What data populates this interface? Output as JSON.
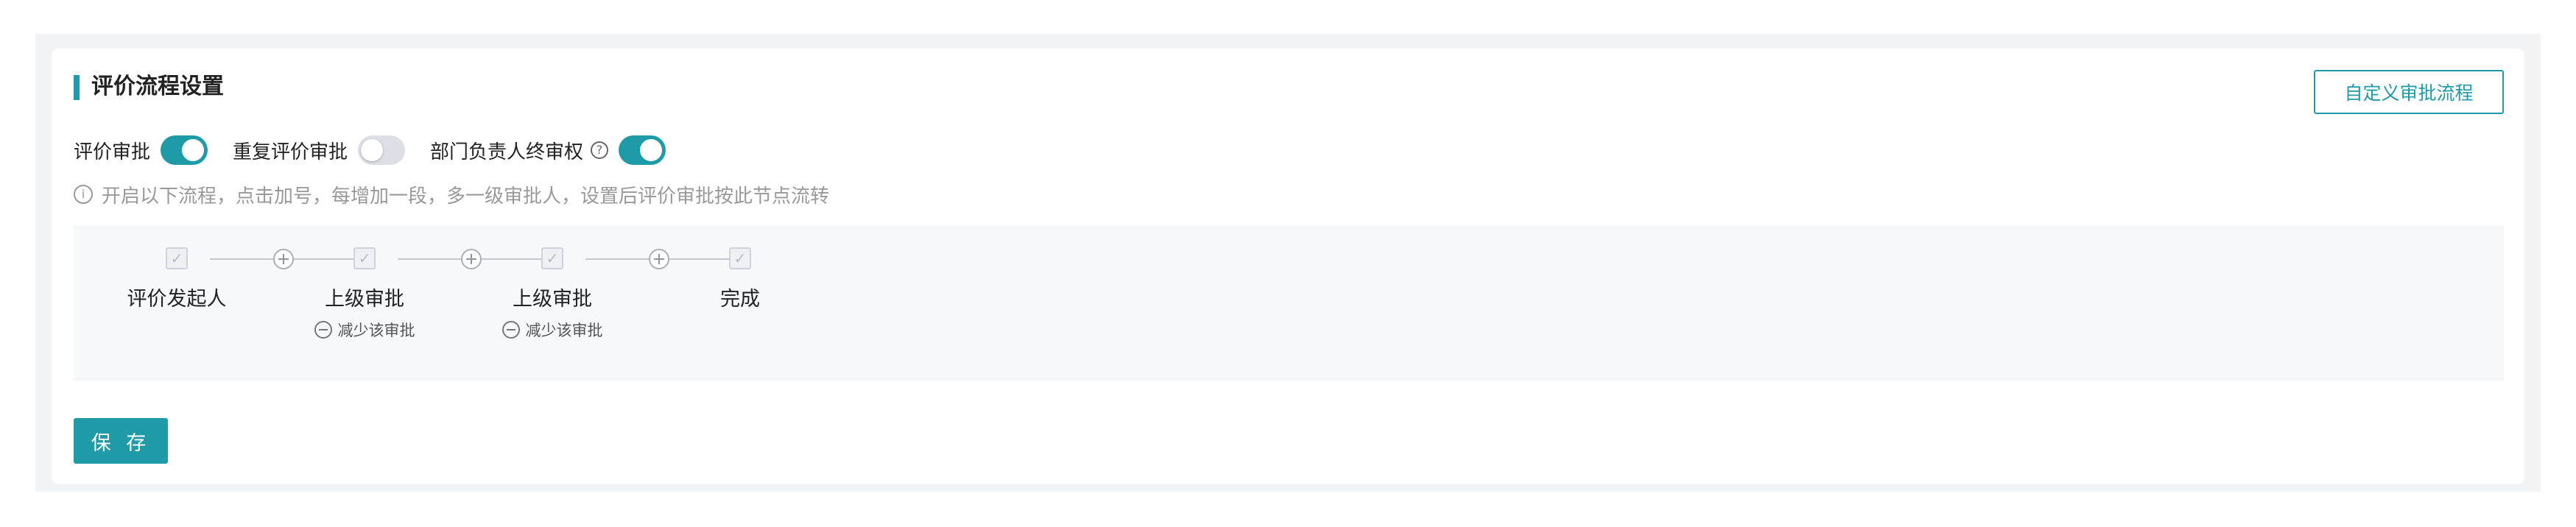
{
  "header": {
    "title": "评价流程设置",
    "custom_button": "自定义审批流程"
  },
  "settings": {
    "eval_approval": {
      "label": "评价审批",
      "enabled": true
    },
    "repeat_approval": {
      "label": "重复评价审批",
      "enabled": false
    },
    "dept_final": {
      "label": "部门负责人终审权",
      "enabled": true
    }
  },
  "hint": "开启以下流程，点击加号，每增加一段，多一级审批人，设置后评价审批按此节点流转",
  "flow": {
    "nodes": [
      {
        "label": "评价发起人"
      },
      {
        "label": "上级审批",
        "reduce": "减少该审批"
      },
      {
        "label": "上级审批",
        "reduce": "减少该审批"
      },
      {
        "label": "完成"
      }
    ]
  },
  "save_button": "保 存"
}
